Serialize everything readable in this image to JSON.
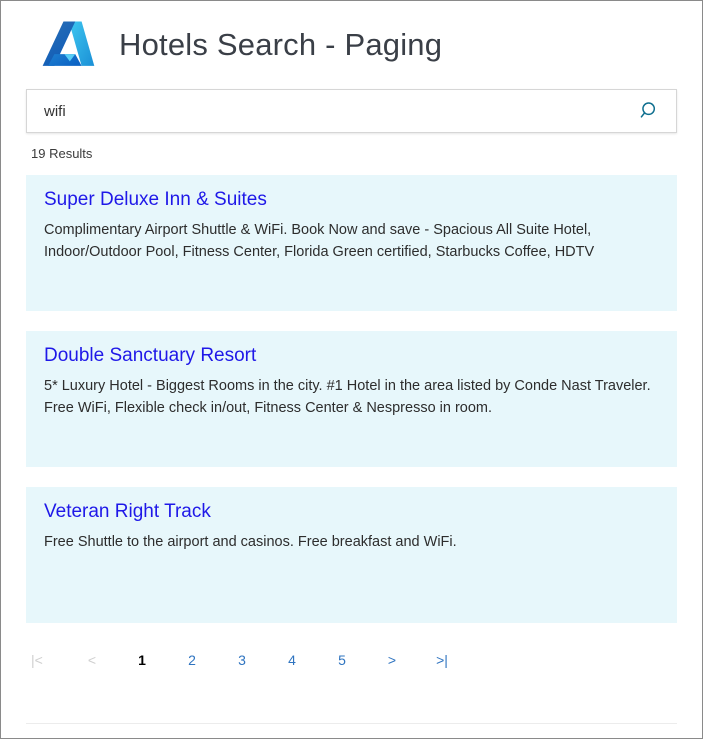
{
  "header": {
    "logo_icon": "azure-logo-icon",
    "title": "Hotels Search - Paging"
  },
  "search": {
    "value": "wifi",
    "placeholder": "Search",
    "button_icon": "search-icon",
    "icon_color": "#0f6f8f"
  },
  "results_summary": "19 Results",
  "results": [
    {
      "title": "Super Deluxe Inn & Suites",
      "description": "Complimentary Airport Shuttle & WiFi.  Book Now and save - Spacious All Suite Hotel, Indoor/Outdoor Pool, Fitness Center, Florida Green certified, Starbucks Coffee, HDTV"
    },
    {
      "title": "Double Sanctuary Resort",
      "description": "5* Luxury Hotel - Biggest Rooms in the city.  #1 Hotel in the area listed by Conde Nast Traveler. Free WiFi, Flexible check in/out, Fitness Center & Nespresso in room."
    },
    {
      "title": "Veteran Right Track",
      "description": "Free Shuttle to the airport and casinos.  Free breakfast and WiFi."
    }
  ],
  "pagination": {
    "items": [
      {
        "label": "|<",
        "name": "first-page",
        "state": "disabled"
      },
      {
        "label": "<",
        "name": "prev-page",
        "state": "disabled"
      },
      {
        "label": "1",
        "name": "page-1",
        "state": "current"
      },
      {
        "label": "2",
        "name": "page-2",
        "state": "link"
      },
      {
        "label": "3",
        "name": "page-3",
        "state": "link"
      },
      {
        "label": "4",
        "name": "page-4",
        "state": "link"
      },
      {
        "label": "5",
        "name": "page-5",
        "state": "link"
      },
      {
        "label": ">",
        "name": "next-page",
        "state": "link"
      },
      {
        "label": ">|",
        "name": "last-page",
        "state": "link"
      }
    ]
  },
  "colors": {
    "card_background": "#e7f7fb",
    "link_blue": "#1f18e8",
    "pagination_blue": "#2f74c0",
    "disabled_gray": "#cfcfcf",
    "title_gray": "#3a3f47"
  }
}
